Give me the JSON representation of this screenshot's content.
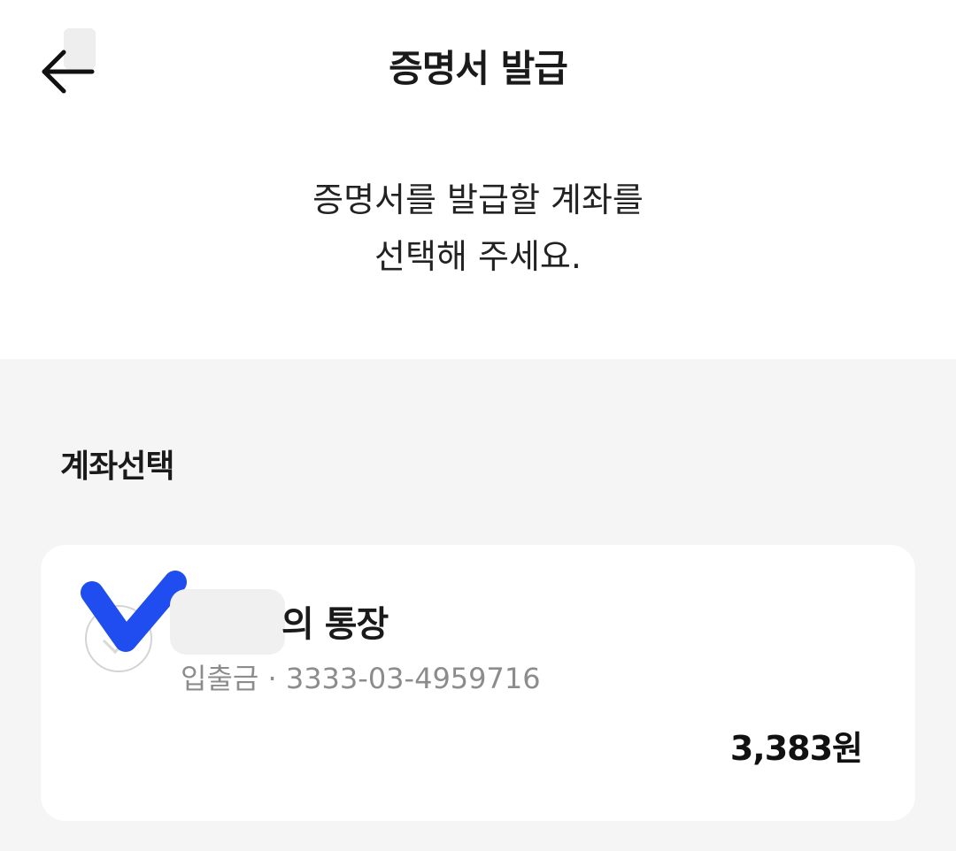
{
  "header": {
    "title": "증명서 발급",
    "back_icon": "arrow-left-icon"
  },
  "instruction": {
    "line1": "증명서를 발급할 계좌를",
    "line2": "선택해 주세요."
  },
  "account_section": {
    "title": "계좌선택",
    "accounts": [
      {
        "name": "의 통장",
        "type": "입출금",
        "separator": "·",
        "number": "3333-03-4959716",
        "subtitle": "입출금 · 3333-03-4959716",
        "balance": "3,383원",
        "selected": true
      }
    ]
  },
  "colors": {
    "check_mark": "#1f4df0",
    "list_background": "#f5f5f5",
    "card_background": "#ffffff",
    "subtext": "#8c8c8c"
  }
}
